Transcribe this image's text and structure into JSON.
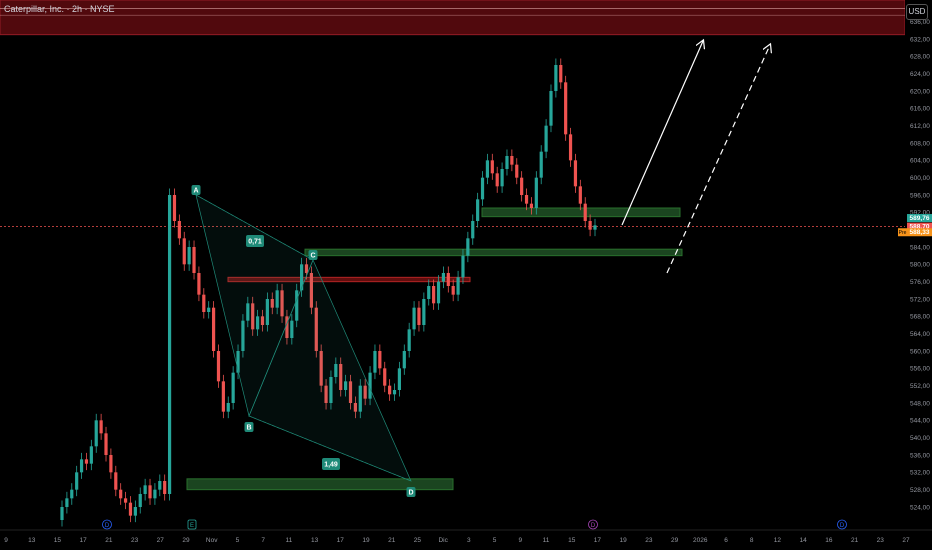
{
  "header": {
    "symbol_line": "Caterpillar, Inc. · 2h · NYSE",
    "currency": "USD"
  },
  "colors": {
    "up": "#26a69a",
    "down": "#ef5350",
    "zone_green": "#1b5e20",
    "zone_red": "#7f0000",
    "accent_orange": "#f7931a"
  },
  "chart_data": {
    "type": "candlestick",
    "ylim": [
      521,
      641
    ],
    "price_ticks": [
      "524,00",
      "528,00",
      "532,00",
      "536,00",
      "540,00",
      "544,00",
      "548,00",
      "552,00",
      "556,00",
      "560,00",
      "564,00",
      "568,00",
      "572,00",
      "576,00",
      "580,00",
      "584,00",
      "588,00",
      "592,00",
      "596,00",
      "600,00",
      "604,00",
      "608,00",
      "612,00",
      "616,00",
      "620,00",
      "624,00",
      "628,00",
      "632,00",
      "636,00"
    ],
    "price_badges": [
      {
        "label": "589,76",
        "value": 589.76,
        "color": "#26a69a"
      },
      {
        "label": "588,70",
        "value": 588.7,
        "color": "#ef5350"
      },
      {
        "label": "588,33",
        "value": 588.33,
        "color": "#f7931a",
        "tag": "Pre"
      }
    ],
    "time_ticks": [
      "9",
      "13",
      "15",
      "17",
      "21",
      "23",
      "27",
      "29",
      "Nov",
      "5",
      "7",
      "11",
      "13",
      "17",
      "19",
      "21",
      "25",
      "Dic",
      "3",
      "5",
      "9",
      "11",
      "15",
      "17",
      "19",
      "23",
      "29",
      "2026",
      "6",
      "8",
      "12",
      "14",
      "16",
      "21",
      "23",
      "27"
    ],
    "current_price": 588.7,
    "pattern_points": [
      {
        "label": "A",
        "price": 596
      },
      {
        "label": "B",
        "price": 545
      },
      {
        "label": "C",
        "price": 581
      },
      {
        "label": "D",
        "price": 530
      }
    ],
    "pattern_ratios": [
      "0,71",
      "1,49"
    ],
    "zones": [
      {
        "kind": "resistance",
        "top": 641,
        "bottom": 633
      },
      {
        "kind": "support",
        "top": 593,
        "bottom": 591
      },
      {
        "kind": "support",
        "top": 583.5,
        "bottom": 582
      },
      {
        "kind": "support",
        "top": 530.5,
        "bottom": 528
      },
      {
        "kind": "broken",
        "top": 577,
        "bottom": 576
      }
    ],
    "event_markers": [
      "D",
      "E",
      "D",
      "D"
    ],
    "candles_close": [
      524,
      526,
      528,
      532,
      535,
      534,
      538,
      544,
      541,
      536,
      532,
      528,
      526,
      525,
      522,
      524,
      527,
      529,
      526,
      528,
      530,
      527,
      596,
      590,
      586,
      580,
      584,
      578,
      573,
      569,
      570,
      560,
      553,
      546,
      548,
      555,
      560,
      567,
      571,
      565,
      568,
      566,
      572,
      570,
      574,
      568,
      563,
      567,
      574,
      580,
      578,
      570,
      560,
      552,
      548,
      554,
      557,
      551,
      553,
      548,
      546,
      552,
      549,
      555,
      560,
      556,
      552,
      550,
      551,
      556,
      560,
      565,
      570,
      566,
      572,
      575,
      571,
      576,
      578,
      575,
      573,
      577,
      582,
      586,
      590,
      595,
      600,
      604,
      601,
      598,
      602,
      605,
      603,
      600,
      596,
      594,
      593,
      600,
      606,
      612,
      620,
      626,
      622,
      610,
      604,
      598,
      594,
      590,
      588,
      589
    ],
    "candles_open": [
      521,
      524,
      526,
      528,
      532,
      535,
      534,
      538,
      544,
      541,
      536,
      532,
      528,
      526,
      525,
      522,
      524,
      527,
      529,
      526,
      528,
      530,
      527,
      596,
      590,
      586,
      580,
      584,
      578,
      573,
      569,
      570,
      560,
      553,
      546,
      548,
      555,
      560,
      567,
      571,
      565,
      568,
      566,
      572,
      570,
      574,
      568,
      563,
      567,
      574,
      580,
      578,
      570,
      560,
      552,
      548,
      554,
      557,
      551,
      553,
      548,
      546,
      552,
      549,
      555,
      560,
      556,
      552,
      550,
      551,
      556,
      560,
      565,
      570,
      566,
      572,
      575,
      571,
      576,
      578,
      575,
      573,
      577,
      582,
      586,
      590,
      595,
      600,
      604,
      601,
      598,
      602,
      605,
      603,
      600,
      596,
      594,
      593,
      600,
      606,
      612,
      620,
      626,
      622,
      610,
      604,
      598,
      594,
      590,
      588
    ]
  }
}
